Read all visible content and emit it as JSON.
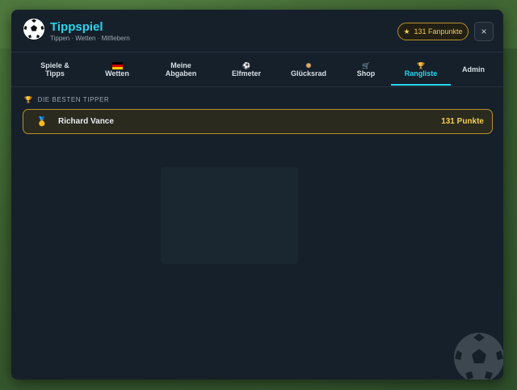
{
  "colors": {
    "accent": "#2ad4f0",
    "gold": "#f3ce4f",
    "panel": "#16202a"
  },
  "app": {
    "title": "Tippspiel",
    "subtitle": "Tippen · Wetten · Mitfiebern",
    "logo_icon": "soccer-ball-icon"
  },
  "header": {
    "points_icon": "star-icon",
    "points_label": "131 Fanpunkte",
    "close_label": "×"
  },
  "tabs": [
    {
      "label": "Spiele &\nTipps",
      "icon": ""
    },
    {
      "label": "Wetten",
      "icon": "german-flag-icon"
    },
    {
      "label": "Meine\nAbgaben",
      "icon": ""
    },
    {
      "label": "Elfmeter",
      "icon": "soccer-ball-icon"
    },
    {
      "label": "Glücksrad",
      "icon": "wheel-icon"
    },
    {
      "label": "Shop",
      "icon": "cart-icon"
    },
    {
      "label": "Rangliste",
      "icon": "trophy-icon",
      "active": true
    },
    {
      "label": "Admin",
      "icon": ""
    }
  ],
  "leaderboard": {
    "section_icon": "trophy-icon",
    "section_title": "DIE BESTEN TIPPER",
    "entries": [
      {
        "medal_icon": "gold-medal-icon",
        "name": "Richard Vance",
        "score": "131 Punkte"
      }
    ]
  }
}
